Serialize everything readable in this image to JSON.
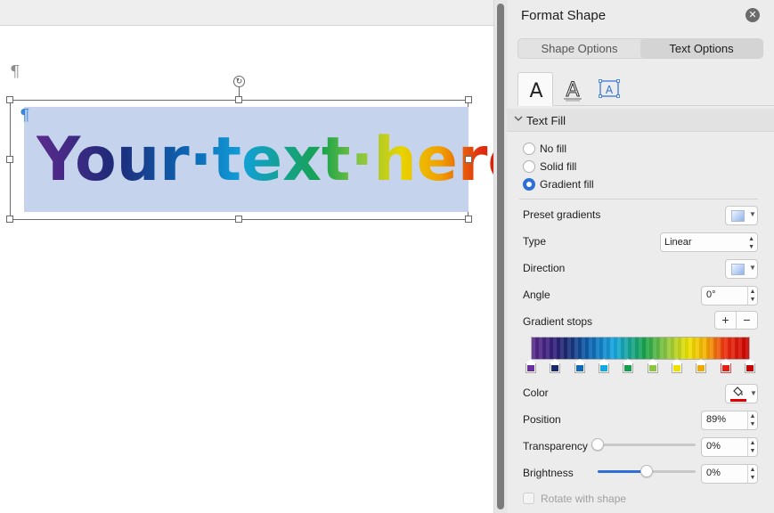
{
  "document": {
    "shape_text": "Your·text·here",
    "pilcrow": "¶",
    "rotate_glyph": "↻"
  },
  "pane": {
    "title": "Format Shape",
    "close_glyph": "✕",
    "tabs": [
      {
        "label": "Shape Options",
        "active": false
      },
      {
        "label": "Text Options",
        "active": true
      }
    ],
    "icon_tabs": [
      {
        "name": "text-fill-outline-icon",
        "glyph": "A",
        "active": true
      },
      {
        "name": "text-effects-icon",
        "glyph": "A",
        "active": false
      },
      {
        "name": "text-box-icon",
        "glyph": "A",
        "active": false
      }
    ],
    "section": {
      "label": "Text Fill",
      "chevron": "⌄",
      "expanded": true
    },
    "fill_options": [
      {
        "label": "No fill",
        "checked": false
      },
      {
        "label": "Solid fill",
        "checked": false
      },
      {
        "label": "Gradient fill",
        "checked": true
      }
    ],
    "properties": {
      "preset_gradients_label": "Preset gradients",
      "type_label": "Type",
      "type_value": "Linear",
      "direction_label": "Direction",
      "angle_label": "Angle",
      "angle_value": "0°",
      "gradient_stops_label": "Gradient stops",
      "add_stop": "+",
      "remove_stop": "−",
      "color_label": "Color",
      "position_label": "Position",
      "position_value": "89%",
      "transparency_label": "Transparency",
      "transparency_value": "0%",
      "transparency_level": 0.0,
      "brightness_label": "Brightness",
      "brightness_value": "0%",
      "brightness_level": 0.5,
      "rotate_with_shape_label": "Rotate with shape",
      "rotate_with_shape_checked": false
    },
    "gradient_stops": [
      {
        "color": "#6a2f9e",
        "selected": false
      },
      {
        "color": "#1a2a6e",
        "selected": false
      },
      {
        "color": "#1068b8",
        "selected": false
      },
      {
        "color": "#14a8e2",
        "selected": false
      },
      {
        "color": "#13a04a",
        "selected": false
      },
      {
        "color": "#8cc63f",
        "selected": false
      },
      {
        "color": "#f0e000",
        "selected": false
      },
      {
        "color": "#f2a800",
        "selected": false
      },
      {
        "color": "#e81e10",
        "selected": true
      },
      {
        "color": "#c40000",
        "selected": false
      }
    ],
    "selected_color": "#e00000",
    "accent_color": "#2d6fd6"
  }
}
